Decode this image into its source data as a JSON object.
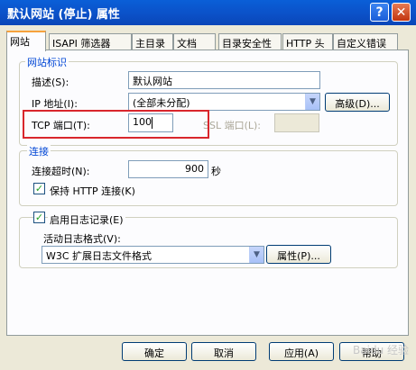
{
  "window": {
    "title": "默认网站 (停止) 属性",
    "help_glyph": "?",
    "close_glyph": "✕"
  },
  "tabs": [
    {
      "label": "网站",
      "active": true
    },
    {
      "label": "ISAPI 筛选器"
    },
    {
      "label": "主目录"
    },
    {
      "label": "文档"
    },
    {
      "label": "目录安全性"
    },
    {
      "label": "HTTP 头"
    },
    {
      "label": "自定义错误"
    }
  ],
  "website_id": {
    "legend": "网站标识",
    "description_label": "描述(S):",
    "description_value": "默认网站",
    "ip_label": "IP 地址(I):",
    "ip_value": "(全部未分配)",
    "advanced_button": "高级(D)...",
    "tcp_label": "TCP 端口(T):",
    "tcp_value": "100",
    "ssl_label": "SSL 端口(L):",
    "ssl_value": ""
  },
  "connection": {
    "legend": "连接",
    "timeout_label": "连接超时(N):",
    "timeout_value": "900",
    "timeout_unit": "秒",
    "keepalive_label": "保持 HTTP 连接(K)",
    "keepalive_checked": true
  },
  "logging": {
    "enable_label": "启用日志记录(E)",
    "enable_checked": true,
    "format_label": "活动日志格式(V):",
    "format_value": "W3C 扩展日志文件格式",
    "properties_button": "属性(P)..."
  },
  "buttons": {
    "ok": "确定",
    "cancel": "取消",
    "apply": "应用(A)",
    "help": "帮助"
  },
  "watermark": "Baidu 经验"
}
